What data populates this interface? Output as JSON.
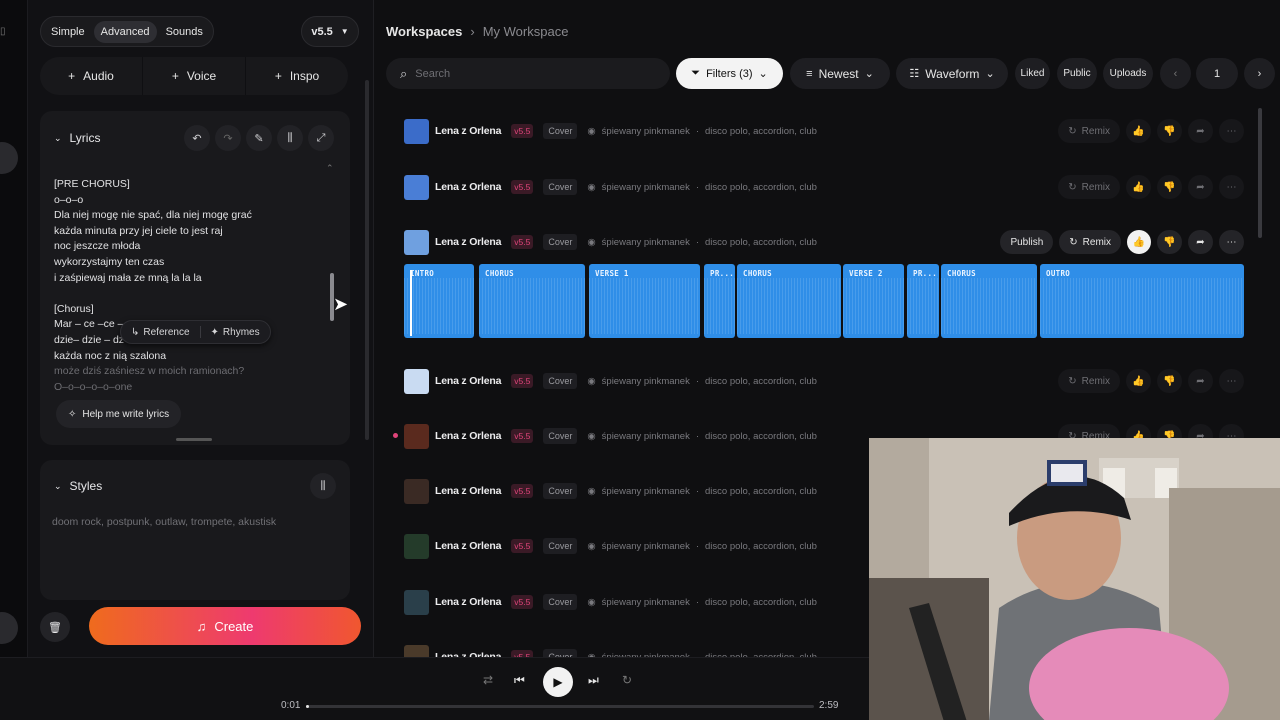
{
  "sidebar": {
    "mode_tabs": [
      "Simple",
      "Advanced",
      "Sounds"
    ],
    "active_mode": "Advanced",
    "version": "v5.5",
    "add_buttons": [
      {
        "label": "Audio",
        "icon": "plus-icon"
      },
      {
        "label": "Voice",
        "icon": "plus-icon"
      },
      {
        "label": "Inspo",
        "icon": "plus-icon"
      }
    ]
  },
  "lyrics": {
    "heading": "Lyrics",
    "lines": [
      "[PRE CHORUS]",
      "o–o–o",
      "Dla niej mogę nie spać, dla niej mogę grać",
      "każda minuta przy jej ciele to jest raj",
      "noc jeszcze młoda",
      "wykorzystajmy ten czas",
      "i zaśpiewaj mała ze mną la la la",
      "",
      "[Chorus]",
      "Mar – ce –ce –",
      "dzie– dzie – dz",
      "każda noc z nią szalona",
      "może dziś zaśniesz w moich ramionach?",
      "O–o–o–o–o–one"
    ],
    "popup": {
      "reference": "Reference",
      "rhymes": "Rhymes"
    },
    "help_button": "Help me write lyrics"
  },
  "styles": {
    "heading": "Styles",
    "text": "doom rock, postpunk, outlaw, trompete, akustisk"
  },
  "create_label": "Create",
  "header": {
    "breadcrumb_root": "Workspaces",
    "breadcrumb_current": "My Workspace"
  },
  "toolbar": {
    "search_placeholder": "Search",
    "filters": "Filters (3)",
    "sort": "Newest",
    "view": "Waveform",
    "liked": "Liked",
    "public": "Public",
    "uploads": "Uploads",
    "page": "1"
  },
  "songs": [
    {
      "title": "Lena z Orlena",
      "version": "v5.5",
      "cover": "Cover",
      "artist": "śpiewany pinkmanek",
      "tags": "disco polo, accordion, club"
    },
    {
      "title": "Lena z Orlena",
      "version": "v5.5",
      "cover": "Cover",
      "artist": "śpiewany pinkmanek",
      "tags": "disco polo, accordion, club"
    },
    {
      "title": "Lena z Orlena",
      "version": "v5.5",
      "cover": "Cover",
      "artist": "śpiewany pinkmanek",
      "tags": "disco polo, accordion, club"
    },
    {
      "title": "Lena z Orlena",
      "version": "v5.5",
      "cover": "Cover",
      "artist": "śpiewany pinkmanek",
      "tags": "disco polo, accordion, club"
    },
    {
      "title": "Lena z Orlena",
      "version": "v5.5",
      "cover": "Cover",
      "artist": "śpiewany pinkmanek",
      "tags": "disco polo, accordion, club"
    },
    {
      "title": "Lena z Orlena",
      "version": "v5.5",
      "cover": "Cover",
      "artist": "śpiewany pinkmanek",
      "tags": "disco polo, accordion, club"
    },
    {
      "title": "Lena z Orlena",
      "version": "v5.5",
      "cover": "Cover",
      "artist": "śpiewany pinkmanek",
      "tags": "disco polo, accordion, club"
    },
    {
      "title": "Lena z Orlena",
      "version": "v5.5",
      "cover": "Cover",
      "artist": "śpiewany pinkmanek",
      "tags": "disco polo, accordion, club"
    },
    {
      "title": "Lena z Orlena",
      "version": "v5.5",
      "cover": "Cover",
      "artist": "śpiewany pinkmanek",
      "tags": "disco polo, accordion, club"
    },
    {
      "title": "Lena z Orlena",
      "version": "v5.5",
      "cover": "Cover",
      "artist": "śpiewany pinkmanek",
      "tags": "disco polo, accordion, club"
    }
  ],
  "row_actions": {
    "remix": "Remix",
    "publish": "Publish"
  },
  "waveform_sections": [
    "INTRO",
    "CHORUS",
    "VERSE 1",
    "PR...",
    "CHORUS",
    "VERSE 2",
    "PR...",
    "CHORUS",
    "OUTRO"
  ],
  "player": {
    "elapsed": "0:01",
    "duration": "2:59",
    "progress_fraction": 0.006
  },
  "colors": {
    "accent_orange": "#ef6b1d",
    "accent_pink": "#ee3a6f",
    "waveform_blue": "#2f8ee8",
    "version_pink": "#e0447a"
  }
}
